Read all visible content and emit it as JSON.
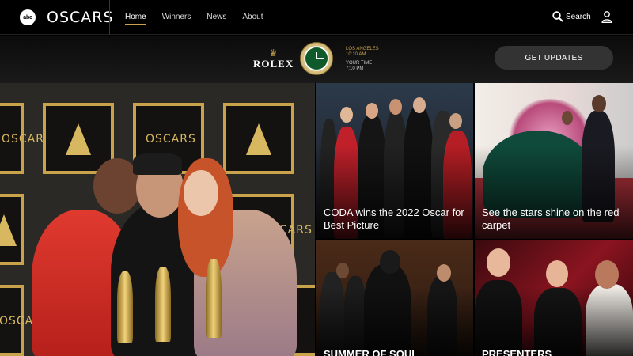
{
  "brand": {
    "network_logo": "abc",
    "site_logo": "OSCARS"
  },
  "nav": {
    "links": [
      {
        "label": "Home",
        "active": true
      },
      {
        "label": "Winners",
        "active": false
      },
      {
        "label": "News",
        "active": false
      },
      {
        "label": "About",
        "active": false
      }
    ],
    "search_label": "Search",
    "search_icon": "search-icon",
    "user_icon": "user-icon"
  },
  "sponsor": {
    "name": "ROLEX",
    "city": "LOS ANGELES",
    "city_time": "10:10 AM",
    "your_time_label": "YOUR TIME",
    "your_time": "7:10 PM",
    "cta": "GET UPDATES"
  },
  "hero": {
    "panel_text": "OSCARS"
  },
  "stories": [
    {
      "title": "CODA wins the 2022 Oscar for Best Picture"
    },
    {
      "title": "See the stars shine on the red carpet"
    },
    {
      "title": "SUMMER OF SOUL"
    },
    {
      "title": "PRESENTERS"
    }
  ],
  "colors": {
    "accent_gold": "#c9a24c",
    "background": "#000000",
    "button": "#333333"
  }
}
